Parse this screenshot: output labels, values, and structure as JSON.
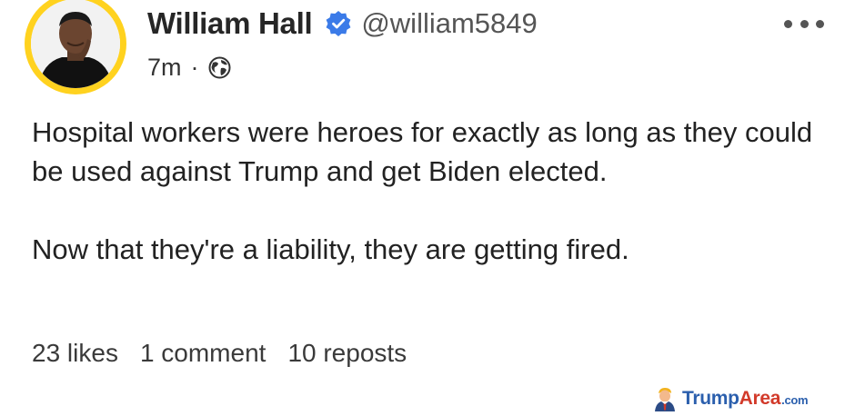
{
  "post": {
    "author_name": "William Hall",
    "handle": "@william5849",
    "timestamp": "7m",
    "separator": "·",
    "body_paragraphs": [
      "Hospital workers were heroes for exactly as long as they could be used against Trump and get Biden elected.",
      "Now that they're a liability, they are getting fired."
    ],
    "stats": {
      "likes": "23 likes",
      "comments": "1 comment",
      "reposts": "10 reposts"
    }
  },
  "icons": {
    "verified": "verified-check-icon",
    "visibility": "globe-icon",
    "more": "more-horizontal-icon"
  },
  "watermark": {
    "brand_part1": "Trump",
    "brand_part2": "Area",
    "brand_suffix": ".com"
  },
  "colors": {
    "avatar_ring": "#ffd21f",
    "verified_badge": "#3b7be8",
    "text_primary": "#222222",
    "text_secondary": "#555555",
    "watermark_blue": "#2b5fad",
    "watermark_red": "#d23a2a"
  }
}
